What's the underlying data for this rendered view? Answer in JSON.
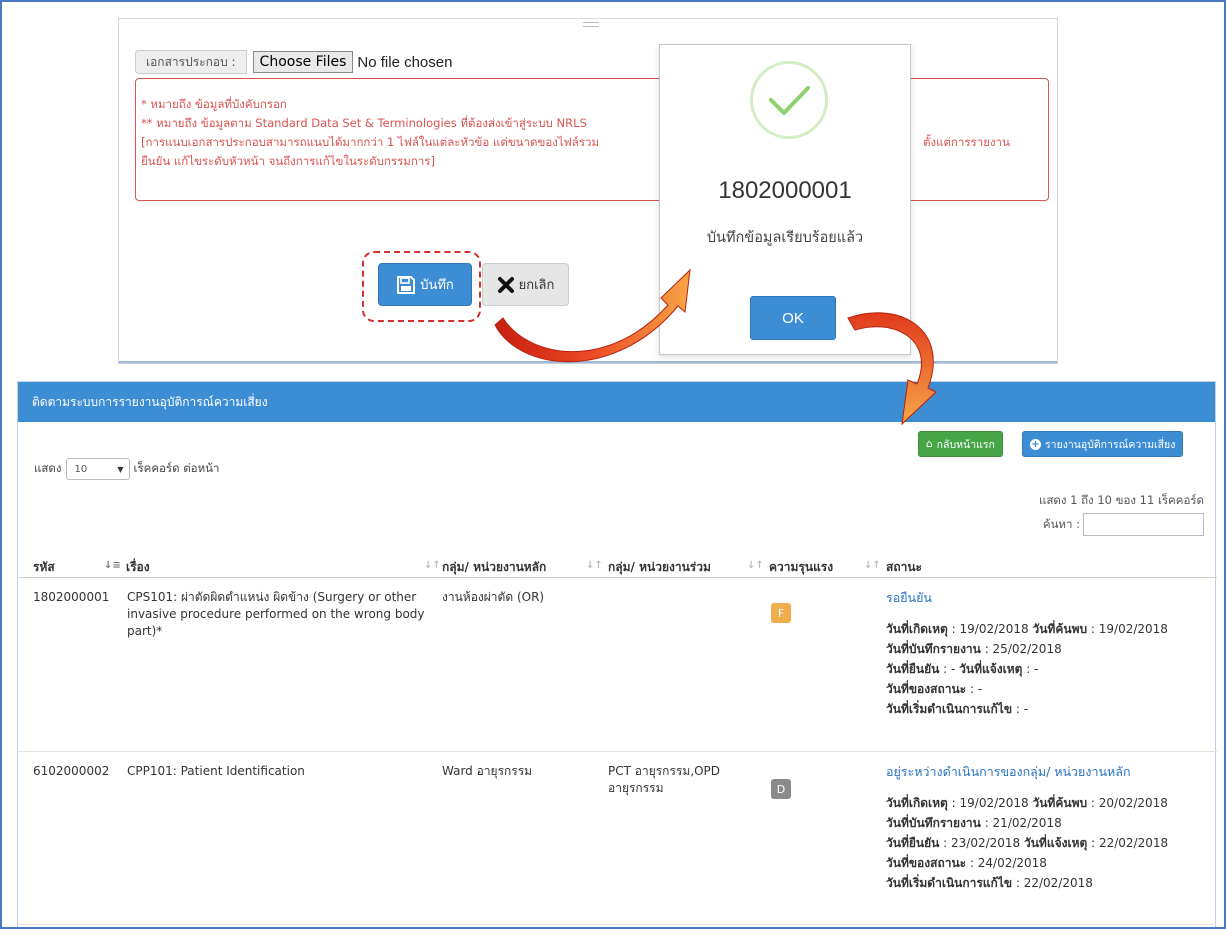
{
  "form": {
    "file_label": "เอกสารประกอบ :",
    "choose_button": "Choose Files",
    "no_file": "No file chosen",
    "alert_lines": [
      "* หมายถึง ข้อมูลที่บังคับกรอก",
      "** หมายถึง ข้อมูลตาม Standard Data Set & Terminologies ที่ต้องส่งเข้าสู่ระบบ NRLS",
      "[การแนบเอกสารประกอบสามารถแนบได้มากกว่า 1 ไฟล์ในแต่ละหัวข้อ แต่ขนาดของไฟล์รวม",
      "ยืนยัน แก้ไขระดับหัวหน้า จนถึงการแก้ไขในระดับกรรมการ]"
    ],
    "alert_tail": "ตั้งแต่การรายงาน",
    "save_label": "บันทึก",
    "cancel_label": "ยกเลิก"
  },
  "modal": {
    "number": "1802000001",
    "message": "บันทึกข้อมูลเรียบร้อยแล้ว",
    "ok_label": "OK"
  },
  "list": {
    "title": "ติดตามระบบการรายงานอุบัติการณ์ความเสี่ยง",
    "home_button": "กลับหน้าแรก",
    "report_button": "รายงานอุบัติการณ์ความเสี่ยง",
    "show_label": "แสดง",
    "page_size": "10",
    "per_page_label": "เร็คคอร์ด ต่อหน้า",
    "info": "แสดง 1 ถึง 10 ของ 11 เร็คคอร์ด",
    "search_label": "ค้นหา :",
    "columns": [
      "รหัส",
      "เรื่อง",
      "กลุ่ม/ หน่วยงานหลัก",
      "กลุ่ม/ หน่วยงานร่วม",
      "ความรุนแรง",
      "สถานะ"
    ],
    "rows": [
      {
        "id": "1802000001",
        "subject": "CPS101: ผ่าตัดผิดตำแหน่ง ผิดข้าง (Surgery or other invasive procedure performed on the wrong body part)*",
        "main_unit": "งานห้องผ่าตัด (OR)",
        "co_unit": "",
        "severity": "F",
        "severity_color": "#f0ad4e",
        "status": "รอยืนยัน",
        "l_occur": "วันที่เกิดเหตุ",
        "v_occur": " : 19/02/2018 ",
        "l_found": "วันที่ค้นพบ",
        "v_found": " : 19/02/2018",
        "l_recorded": "วันที่บันทึกรายงาน",
        "v_recorded": " : 25/02/2018",
        "l_confirmed": "วันที่ยืนยัน",
        "v_confirmed": " : - ",
        "l_notified": "วันที่แจ้งเหตุ",
        "v_notified": " : -",
        "l_status_date": "วันที่ของสถานะ",
        "v_status_date": " : -",
        "l_fix_start": "วันที่เริ่มดำเนินการแก้ไข",
        "v_fix_start": " : -"
      },
      {
        "id": "6102000002",
        "subject": "CPP101: Patient Identification",
        "main_unit": "Ward อายุรกรรม",
        "co_unit": "PCT อายุรกรรม,OPD อายุรกรรม",
        "severity": "D",
        "severity_color": "#8a8a8a",
        "status": "อยู่ระหว่างดำเนินการของกลุ่ม/ หน่วยงานหลัก",
        "l_occur": "วันที่เกิดเหตุ",
        "v_occur": " : 19/02/2018 ",
        "l_found": "วันที่ค้นพบ",
        "v_found": " : 20/02/2018",
        "l_recorded": "วันที่บันทึกรายงาน",
        "v_recorded": " : 21/02/2018",
        "l_confirmed": "วันที่ยืนยัน",
        "v_confirmed": " : 23/02/2018 ",
        "l_notified": "วันที่แจ้งเหตุ",
        "v_notified": " : 22/02/2018",
        "l_status_date": "วันที่ของสถานะ",
        "v_status_date": " : 24/02/2018",
        "l_fix_start": "วันที่เริ่มดำเนินการแก้ไข",
        "v_fix_start": " : 22/02/2018"
      }
    ]
  },
  "colors": {
    "primary": "#3c8dd3",
    "success": "#46a546",
    "danger": "#d9534f",
    "arrow": "#e4331d",
    "arrow_light": "#f6a441"
  }
}
